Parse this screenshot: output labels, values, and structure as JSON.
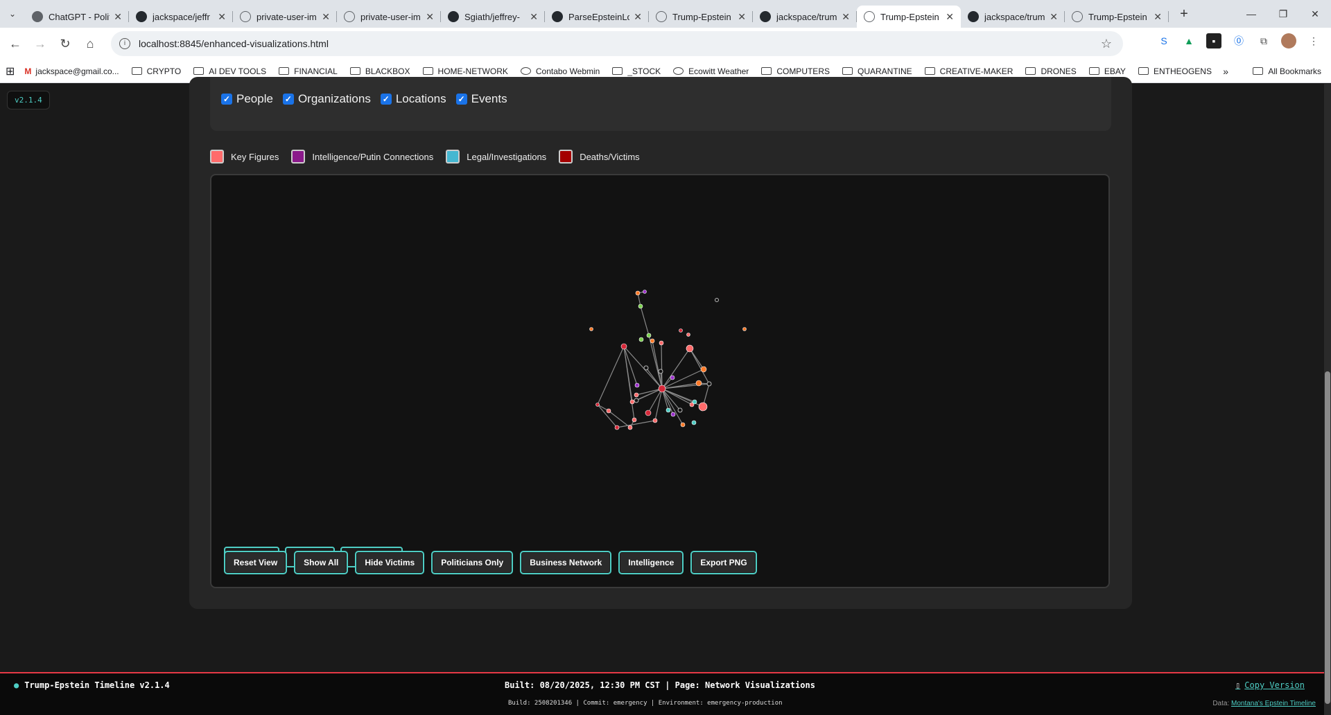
{
  "browser": {
    "tabs": [
      {
        "title": "ChatGPT - Polit",
        "icon": "chatgpt-icon"
      },
      {
        "title": "jackspace/jeffr",
        "icon": "github-icon"
      },
      {
        "title": "private-user-im",
        "icon": "globe-icon"
      },
      {
        "title": "private-user-im",
        "icon": "globe-icon"
      },
      {
        "title": "Sgiath/jeffrey-",
        "icon": "github-icon"
      },
      {
        "title": "ParseEpsteinLo",
        "icon": "github-icon"
      },
      {
        "title": "Trump-Epstein",
        "icon": "globe-icon"
      },
      {
        "title": "jackspace/trum",
        "icon": "github-icon"
      },
      {
        "title": "Trump-Epstein",
        "icon": "globe-icon",
        "active": true
      },
      {
        "title": "jackspace/trum",
        "icon": "github-icon"
      },
      {
        "title": "Trump-Epstein",
        "icon": "globe-icon"
      }
    ],
    "url": "localhost:8845/enhanced-visualizations.html",
    "bookmarks": [
      {
        "label": "jackspace@gmail.co...",
        "type": "gmail"
      },
      {
        "label": "CRYPTO",
        "type": "folder"
      },
      {
        "label": "AI DEV TOOLS",
        "type": "folder"
      },
      {
        "label": "FINANCIAL",
        "type": "folder"
      },
      {
        "label": "BLACKBOX",
        "type": "folder"
      },
      {
        "label": "HOME-NETWORK",
        "type": "folder"
      },
      {
        "label": "Contabo Webmin",
        "type": "site"
      },
      {
        "label": "_STOCK",
        "type": "folder"
      },
      {
        "label": "Ecowitt Weather",
        "type": "site"
      },
      {
        "label": "COMPUTERS",
        "type": "folder"
      },
      {
        "label": "QUARANTINE",
        "type": "folder"
      },
      {
        "label": "CREATIVE-MAKER",
        "type": "folder"
      },
      {
        "label": "DRONES",
        "type": "folder"
      },
      {
        "label": "EBAY",
        "type": "folder"
      },
      {
        "label": "ENTHEOGENS",
        "type": "folder"
      }
    ],
    "all_bookmarks": "All Bookmarks"
  },
  "page": {
    "version_badge": "v2.1.4",
    "filters": [
      {
        "label": "People",
        "checked": true
      },
      {
        "label": "Organizations",
        "checked": true
      },
      {
        "label": "Locations",
        "checked": true
      },
      {
        "label": "Events",
        "checked": true
      }
    ],
    "legend": [
      {
        "label": "Key Figures",
        "color": "#ff6b6b"
      },
      {
        "label": "Intelligence/Putin Connections",
        "color": "#8b1a8b"
      },
      {
        "label": "Legal/Investigations",
        "color": "#45b7d1"
      },
      {
        "label": "Deaths/Victims",
        "color": "#a40000"
      }
    ],
    "controls": [
      "Reset View",
      "Show All",
      "Hide Victims",
      "Politicians Only",
      "Business Network",
      "Intelligence",
      "Export PNG"
    ]
  },
  "graph": {
    "node_colors": {
      "key": "#ff6b6b",
      "intel": "#9b30c9",
      "legal": "#4ecdc4",
      "victim": "#d62839",
      "location": "#7bd14e",
      "event": "#ff7a29",
      "other": "#f7d33c",
      "neutral": "#121212"
    }
  },
  "footer": {
    "title": "Trump-Epstein Timeline v2.1.4",
    "build_line": "Built: 08/20/2025, 12:30 PM CST | Page: Network Visualizations",
    "build_meta": "Build: 2508201346 | Commit: emergency | Environment: emergency-production",
    "copy_version": "Copy Version",
    "data_label": "Data:",
    "data_link": "Montana's Epstein Timeline"
  }
}
